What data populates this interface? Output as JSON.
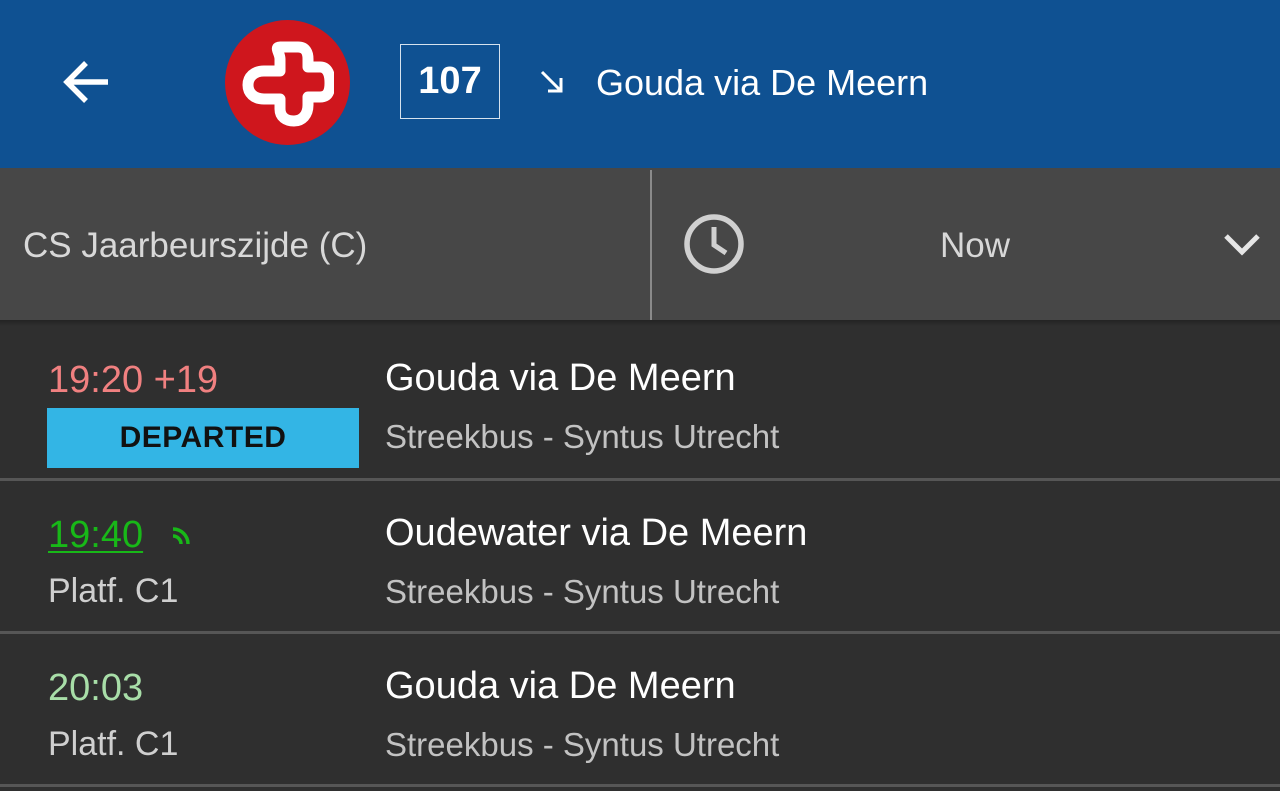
{
  "header": {
    "back_icon": "arrow-left-icon",
    "logo_icon": "ov-logo-cross",
    "line_number": "107",
    "direction_icon": "arrow-down-right-icon",
    "title": "Gouda via De Meern",
    "background_color": "#0f5192",
    "logo_color": "#cf161d"
  },
  "filters": {
    "stop": "CS Jaarbeurszijde (C)",
    "time_icon": "clock-icon",
    "time": "Now",
    "dropdown_icon": "chevron-down-icon"
  },
  "departures": [
    {
      "time": "19:20 +19",
      "status": "late",
      "status_color": "#f08080",
      "badge": "DEPARTED",
      "badge_color": "#33b5e5",
      "destination": "Gouda via De Meern",
      "operator": "Streekbus - Syntus Utrecht"
    },
    {
      "time": "19:40",
      "status": "realtime",
      "status_color": "#18b818",
      "realtime_icon": "realtime-signal-icon",
      "platform": "Platf. C1",
      "destination": "Oudewater via De Meern",
      "operator": "Streekbus - Syntus Utrecht"
    },
    {
      "time": "20:03",
      "status": "planned",
      "status_color": "#a8dea8",
      "platform": "Platf. C1",
      "destination": "Gouda via De Meern",
      "operator": "Streekbus - Syntus Utrecht"
    }
  ]
}
